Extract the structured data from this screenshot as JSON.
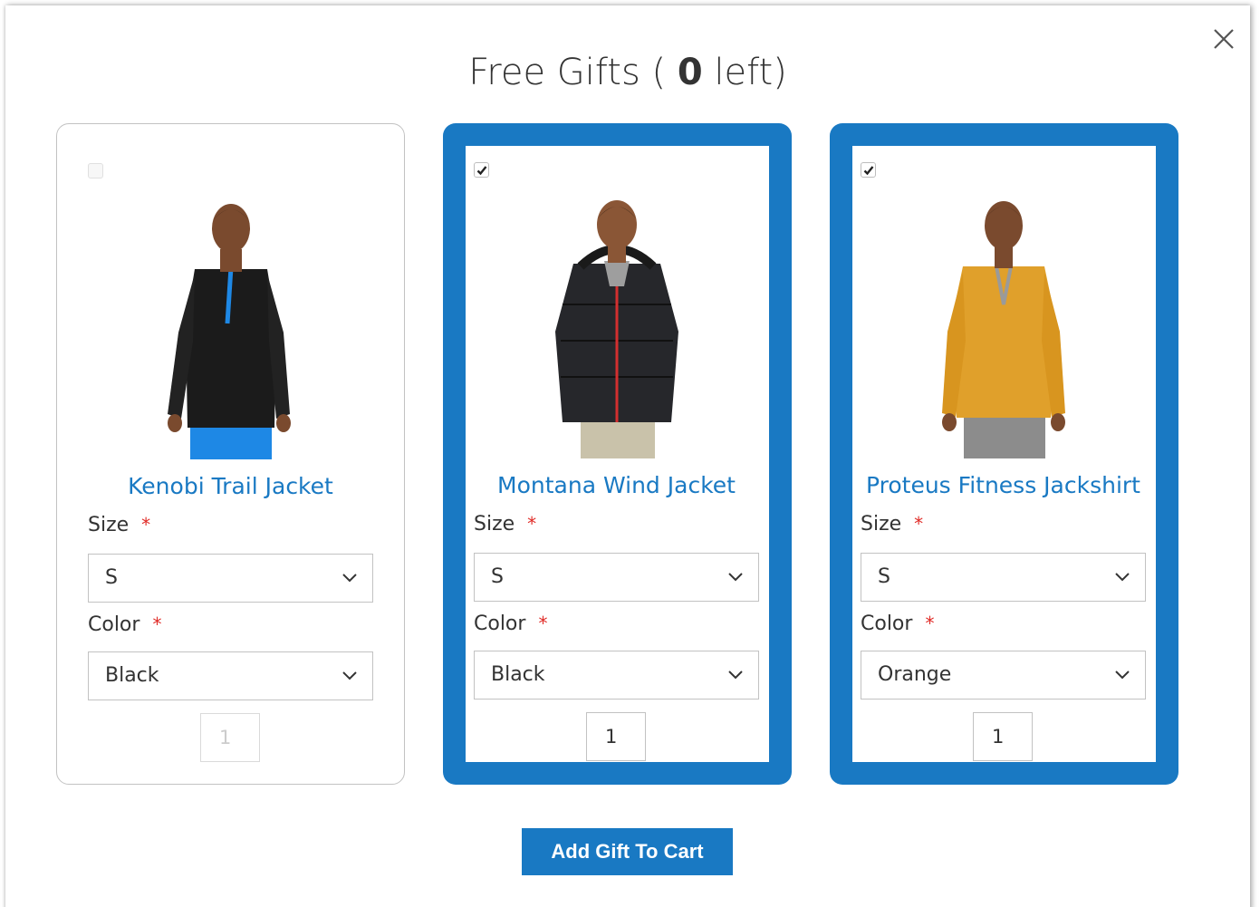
{
  "modal": {
    "title_prefix": "Free Gifts ( ",
    "title_count": "0",
    "title_suffix": " left)",
    "close_glyph": "close-icon"
  },
  "products": [
    {
      "name": "Kenobi Trail Jacket",
      "selected": false,
      "size_label": "Size",
      "size_value": "S",
      "color_label": "Color",
      "color_value": "Black",
      "qty": "1"
    },
    {
      "name": "Montana Wind Jacket",
      "selected": true,
      "size_label": "Size",
      "size_value": "S",
      "color_label": "Color",
      "color_value": "Black",
      "qty": "1"
    },
    {
      "name": "Proteus Fitness Jackshirt",
      "selected": true,
      "size_label": "Size",
      "size_value": "S",
      "color_label": "Color",
      "color_value": "Orange",
      "qty": "1"
    }
  ],
  "required_mark": "*",
  "actions": {
    "add_label": "Add Gift To Cart"
  },
  "colors": {
    "accent": "#1979c3",
    "required": "#e02b27",
    "border": "#c2c2c2"
  }
}
